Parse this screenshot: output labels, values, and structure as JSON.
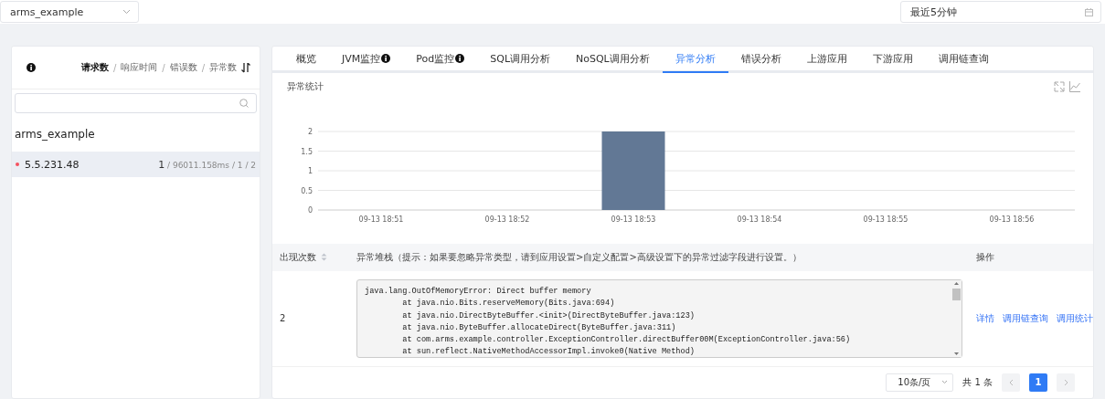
{
  "app_select": {
    "value": "arms_example"
  },
  "time_select": {
    "value": "最近5分钟"
  },
  "side_panel": {
    "sort_options": [
      {
        "label": "请求数",
        "selected": true
      },
      {
        "label": "响应时间",
        "selected": false
      },
      {
        "label": "错误数",
        "selected": false
      },
      {
        "label": "异常数",
        "selected": false
      }
    ],
    "separator": "/",
    "group": "arms_example",
    "items": [
      {
        "name": "5.5.231.48",
        "color": "#f5515f",
        "selected": true,
        "stats": "**1** / 96011.158ms / 1 / 2"
      }
    ]
  },
  "tabs": [
    {
      "label": "概览",
      "selected": false,
      "info": false
    },
    {
      "label": "JVM监控",
      "selected": false,
      "info": true
    },
    {
      "label": "Pod监控",
      "selected": false,
      "info": true
    },
    {
      "label": "SQL调用分析",
      "selected": false,
      "info": false
    },
    {
      "label": "NoSQL调用分析",
      "selected": false,
      "info": false
    },
    {
      "label": "异常分析",
      "selected": true,
      "info": false
    },
    {
      "label": "错误分析",
      "selected": false,
      "info": false
    },
    {
      "label": "上游应用",
      "selected": false,
      "info": false
    },
    {
      "label": "下游应用",
      "selected": false,
      "info": false
    },
    {
      "label": "调用链查询",
      "selected": false,
      "info": false
    }
  ],
  "chart_title": "异常统计",
  "chart_data": {
    "type": "bar",
    "categories": [
      "09-13 18:51",
      "09-13 18:52",
      "09-13 18:53",
      "09-13 18:54",
      "09-13 18:55",
      "09-13 18:56"
    ],
    "series": [
      {
        "color": "#627895",
        "values": [
          0,
          0,
          2,
          0,
          0,
          0
        ]
      }
    ],
    "grid": true,
    "ylim": [
      0,
      2
    ],
    "yticks": [
      0,
      0.5,
      1,
      1.5,
      2
    ]
  },
  "table": {
    "columns": [
      {
        "label": "出现次数",
        "sortable": true
      },
      {
        "label": "异常堆栈（提示：如果要忽略异常类型，请到应用设置>自定义配置>高级设置下的异常过滤字段进行设置。）",
        "sortable": false
      },
      {
        "label": "操作",
        "sortable": false
      }
    ],
    "rows": [
      {
        "count": "2",
        "stack": [
          "java.lang.OutOfMemoryError: Direct buffer memory",
          "        at java.nio.Bits.reserveMemory(Bits.java:694)",
          "        at java.nio.DirectByteBuffer.<init>(DirectByteBuffer.java:123)",
          "        at java.nio.ByteBuffer.allocateDirect(ByteBuffer.java:311)",
          "        at com.arms.example.controller.ExceptionController.directBuffer00M(ExceptionController.java:56)",
          "        at sun.reflect.NativeMethodAccessorImpl.invoke0(Native Method)"
        ],
        "actions": [
          "详情",
          "调用链查询",
          "调用统计"
        ]
      }
    ]
  },
  "pagination": {
    "page_size": "10条/页",
    "total": "共 1 条",
    "pages": [
      {
        "label": "1",
        "selected": true
      }
    ]
  }
}
